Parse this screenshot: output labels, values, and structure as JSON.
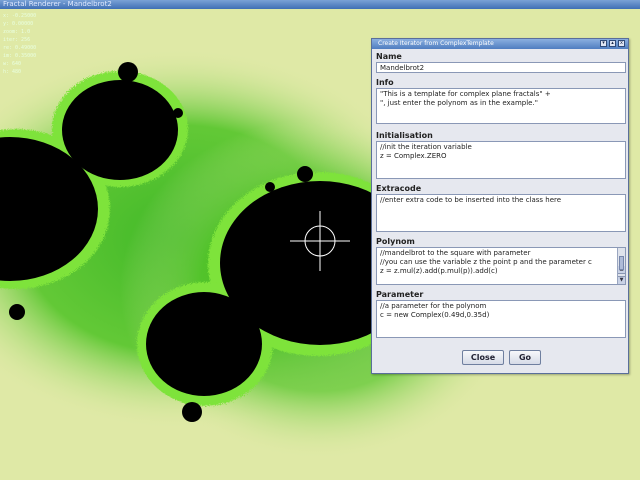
{
  "window": {
    "title": "Fractal Renderer - Mandelbrot2"
  },
  "overlay": {
    "items": [
      "x: -0.25000",
      "y: 0.00000",
      "zoom: 1.0",
      "iter: 256",
      "re: 0.49000",
      "im: 0.35000",
      "w: 640",
      "h: 480"
    ]
  },
  "dialog": {
    "title": "Create Iterator from ComplexTemplate",
    "controls": [
      "▾",
      "▴",
      "x"
    ],
    "name_label": "Name",
    "name_value": "Mandelbrot2",
    "info_label": "Info",
    "info_lines": [
      "\"This is a template for complex plane fractals\" +",
      "\", just enter the polynom as in the example.\""
    ],
    "init_label": "Initialisation",
    "init_lines": [
      "//init the iteration variable",
      "z = Complex.ZERO"
    ],
    "extra_label": "Extracode",
    "extra_lines": [
      "//enter extra code to be inserted into the class here"
    ],
    "polynom_label": "Polynom",
    "polynom_lines": [
      "//mandelbrot to the square with parameter",
      "//you can use the variable z the point p and the parameter c",
      "z = z.mul(z).add(p.mul(p)).add(c)"
    ],
    "param_label": "Parameter",
    "param_lines": [
      "//a parameter for the polynom",
      "c = new Complex(0.49d,0.35d)"
    ],
    "close_label": "Close",
    "go_label": "Go"
  },
  "colors": {
    "fractal_bg": "#dfe9a8",
    "fractal_green": "#33b51e",
    "set_fill": "#000000",
    "accent_title": "#4f7dc0"
  }
}
